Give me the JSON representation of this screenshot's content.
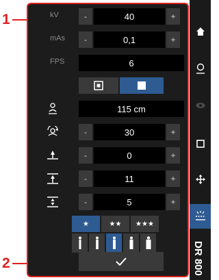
{
  "callouts": {
    "one": "1",
    "two": "2"
  },
  "params": {
    "kv": {
      "label": "kV",
      "value": "40"
    },
    "mas": {
      "label": "mAs",
      "value": "0,1"
    },
    "fps": {
      "label": "FPS",
      "value": "6"
    }
  },
  "distance": {
    "value": "115 cm"
  },
  "rotation": {
    "value": "30"
  },
  "height_a": {
    "value": "0"
  },
  "height_b": {
    "value": "11"
  },
  "height_c": {
    "value": "5"
  },
  "controls": {
    "minus": "-",
    "plus": "+"
  },
  "stars": [
    "★",
    "★★",
    "★★★"
  ],
  "sidebar": {
    "vertical_label": "DR 800"
  },
  "colors": {
    "accent": "#2e5b92",
    "callout": "#e02020",
    "panel": "#1c1c1c"
  }
}
